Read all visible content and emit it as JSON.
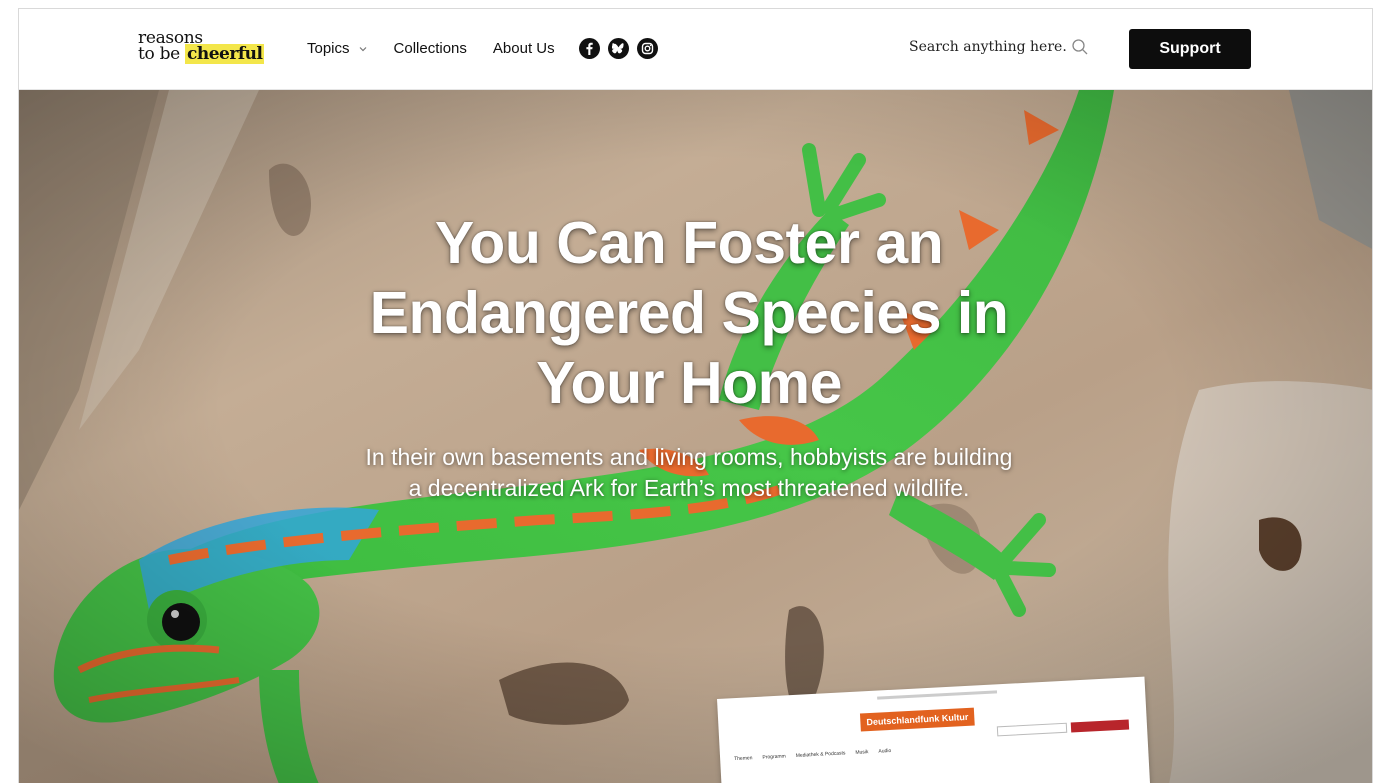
{
  "logo": {
    "line1": "reasons",
    "line2_prefix": "to be ",
    "line2_highlight": "cheerful",
    "highlight_color": "#f3e64a"
  },
  "nav": {
    "items": [
      {
        "label": "Topics",
        "has_dropdown": true
      },
      {
        "label": "Collections",
        "has_dropdown": false
      },
      {
        "label": "About Us",
        "has_dropdown": false
      }
    ],
    "socials": [
      "facebook-icon",
      "bluesky-icon",
      "instagram-icon"
    ]
  },
  "search": {
    "placeholder": "Search anything here..."
  },
  "support": {
    "label": "Support"
  },
  "hero": {
    "headline": "You Can Foster an Endangered Species in Your Home",
    "dek": "In their own basements and living rooms, hobbyists are building a decentralized Ark for Earth’s most threatened wildlife."
  },
  "overlay": {
    "brand": "Deutschlandfunk Kultur",
    "brand_color": "#e2621f",
    "nav_items": [
      "Themen",
      "Programm",
      "Mediathek & Podcasts",
      "Musik",
      "Audio"
    ]
  },
  "colors": {
    "accent": "#f3e64a",
    "button_bg": "#0d0d0d",
    "gecko_green": "#3dbb3f",
    "gecko_orange": "#e86a2e",
    "gecko_blue": "#33a6d8"
  }
}
